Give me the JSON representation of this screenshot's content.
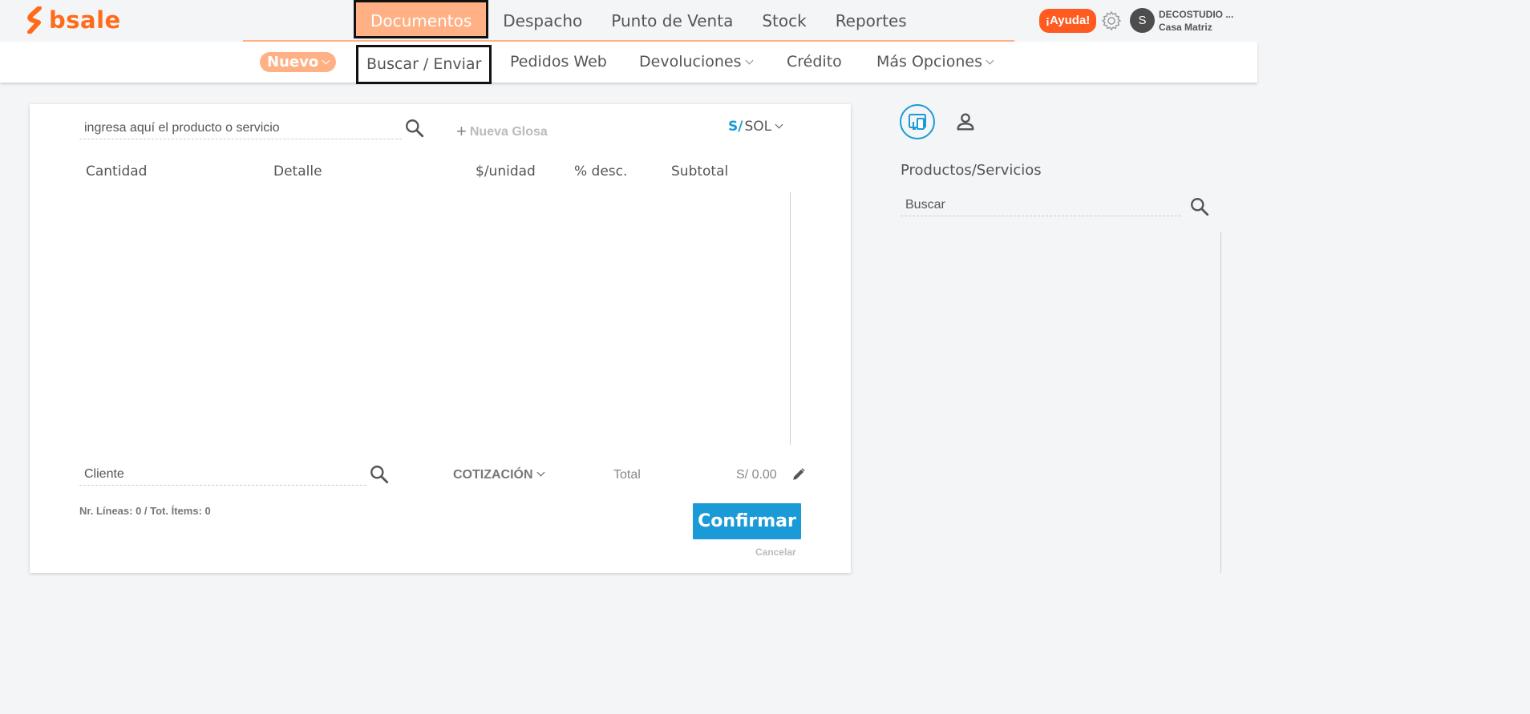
{
  "brand": {
    "name": "bsale",
    "color": "#ff6b1a"
  },
  "topnav": {
    "items": [
      "Documentos",
      "Despacho",
      "Punto de Venta",
      "Stock",
      "Reportes"
    ],
    "active": "Documentos"
  },
  "header": {
    "help_label": "¡Ayuda!",
    "avatar_initial": "S",
    "company_name": "DECOSTUDIO ...",
    "branch": "Casa Matriz"
  },
  "subnav": {
    "nuevo": "Nuevo",
    "buscar": "Buscar / Enviar",
    "pedidos": "Pedidos Web",
    "devoluciones": "Devoluciones",
    "credito": "Crédito",
    "mas": "Más Opciones"
  },
  "sale": {
    "product_placeholder": "ingresa aquí el producto o servicio",
    "glosa_label": "Nueva Glosa",
    "currency_symbol": "S/",
    "currency_code": "SOL",
    "columns": [
      "Cantidad",
      "Detalle",
      "$/unidad",
      "% desc.",
      "Subtotal"
    ],
    "client_placeholder": "Cliente",
    "document_type": "COTIZACIÓN",
    "total_label": "Total",
    "total_value": "S/ 0.00",
    "lines_info": "Nr. Líneas: 0 / Tot. Ítems: 0",
    "confirm_label": "Confirmar",
    "cancel_label": "Cancelar"
  },
  "panel": {
    "title": "Productos/Servicios",
    "search_placeholder": "Buscar"
  },
  "colors": {
    "accent": "#ffb185",
    "primary": "#1a9bd7",
    "help": "#ff5a1f"
  }
}
